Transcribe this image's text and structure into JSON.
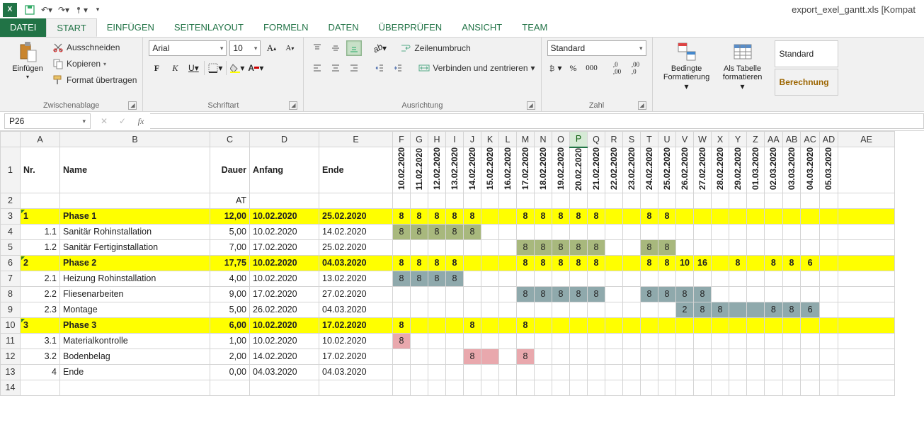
{
  "app": {
    "title": "export_exel_gantt.xls  [Kompat"
  },
  "tabs": {
    "datei": "DATEI",
    "start": "START",
    "einfuegen": "EINFÜGEN",
    "seitenlayout": "SEITENLAYOUT",
    "formeln": "FORMELN",
    "daten": "DATEN",
    "ueberpruefen": "ÜBERPRÜFEN",
    "ansicht": "ANSICHT",
    "team": "TEAM"
  },
  "ribbon": {
    "clipboard": {
      "paste": "Einfügen",
      "cut": "Ausschneiden",
      "copy": "Kopieren",
      "format_painter": "Format übertragen",
      "label": "Zwischenablage"
    },
    "font": {
      "name": "Arial",
      "size": "10",
      "bold": "F",
      "italic": "K",
      "underline": "U",
      "label": "Schriftart"
    },
    "align": {
      "wrap": "Zeilenumbruch",
      "merge": "Verbinden und zentrieren",
      "label": "Ausrichtung"
    },
    "number": {
      "format": "Standard",
      "label": "Zahl"
    },
    "styles": {
      "cond": "Bedingte\nFormatierung",
      "table": "Als Tabelle\nformatieren",
      "s1": "Standard",
      "s2": "Berechnung"
    }
  },
  "namebox": "P26",
  "columns": [
    "A",
    "B",
    "C",
    "D",
    "E",
    "F",
    "G",
    "H",
    "I",
    "J",
    "K",
    "L",
    "M",
    "N",
    "O",
    "P",
    "Q",
    "R",
    "S",
    "T",
    "U",
    "V",
    "W",
    "X",
    "Y",
    "Z",
    "AA",
    "AB",
    "AC",
    "AD",
    "AE"
  ],
  "dates": [
    "10.02.2020",
    "11.02.2020",
    "12.02.2020",
    "13.02.2020",
    "14.02.2020",
    "15.02.2020",
    "16.02.2020",
    "17.02.2020",
    "18.02.2020",
    "19.02.2020",
    "20.02.2020",
    "21.02.2020",
    "22.02.2020",
    "23.02.2020",
    "24.02.2020",
    "25.02.2020",
    "26.02.2020",
    "27.02.2020",
    "28.02.2020",
    "29.02.2020",
    "01.03.2020",
    "02.03.2020",
    "03.03.2020",
    "04.03.2020",
    "05.03.2020"
  ],
  "headers": {
    "nr": "Nr.",
    "name": "Name",
    "dauer": "Dauer",
    "anfang": "Anfang",
    "ende": "Ende",
    "at": "AT"
  },
  "rows": [
    {
      "r": 3,
      "phase": true,
      "nr": "1",
      "name": "Phase 1",
      "dauer": "12,00",
      "anfang": "10.02.2020",
      "ende": "25.02.2020",
      "cells": [
        {
          "d": 0,
          "v": "8"
        },
        {
          "d": 1,
          "v": "8"
        },
        {
          "d": 2,
          "v": "8"
        },
        {
          "d": 3,
          "v": "8"
        },
        {
          "d": 4,
          "v": "8"
        },
        {
          "d": 7,
          "v": "8"
        },
        {
          "d": 8,
          "v": "8"
        },
        {
          "d": 9,
          "v": "8"
        },
        {
          "d": 10,
          "v": "8"
        },
        {
          "d": 11,
          "v": "8"
        },
        {
          "d": 14,
          "v": "8"
        },
        {
          "d": 15,
          "v": "8"
        }
      ]
    },
    {
      "r": 4,
      "nr": "1.1",
      "name": "Sanitär Rohinstallation",
      "dauer": "5,00",
      "anfang": "10.02.2020",
      "ende": "14.02.2020",
      "cells": [
        {
          "d": 0,
          "v": "8",
          "c": "g1"
        },
        {
          "d": 1,
          "v": "8",
          "c": "g1"
        },
        {
          "d": 2,
          "v": "8",
          "c": "g1"
        },
        {
          "d": 3,
          "v": "8",
          "c": "g1"
        },
        {
          "d": 4,
          "v": "8",
          "c": "g1"
        }
      ]
    },
    {
      "r": 5,
      "nr": "1.2",
      "name": "Sanitär Fertiginstallation",
      "dauer": "7,00",
      "anfang": "17.02.2020",
      "ende": "25.02.2020",
      "cells": [
        {
          "d": 7,
          "v": "8",
          "c": "g1"
        },
        {
          "d": 8,
          "v": "8",
          "c": "g1"
        },
        {
          "d": 9,
          "v": "8",
          "c": "g1"
        },
        {
          "d": 10,
          "v": "8",
          "c": "g1"
        },
        {
          "d": 11,
          "v": "8",
          "c": "g1"
        },
        {
          "d": 14,
          "v": "8",
          "c": "g1"
        },
        {
          "d": 15,
          "v": "8",
          "c": "g1"
        }
      ]
    },
    {
      "r": 6,
      "phase": true,
      "nr": "2",
      "name": "Phase 2",
      "dauer": "17,75",
      "anfang": "10.02.2020",
      "ende": "04.03.2020",
      "cells": [
        {
          "d": 0,
          "v": "8"
        },
        {
          "d": 1,
          "v": "8"
        },
        {
          "d": 2,
          "v": "8"
        },
        {
          "d": 3,
          "v": "8"
        },
        {
          "d": 7,
          "v": "8"
        },
        {
          "d": 8,
          "v": "8"
        },
        {
          "d": 9,
          "v": "8"
        },
        {
          "d": 10,
          "v": "8"
        },
        {
          "d": 11,
          "v": "8"
        },
        {
          "d": 14,
          "v": "8"
        },
        {
          "d": 15,
          "v": "8"
        },
        {
          "d": 16,
          "v": "10"
        },
        {
          "d": 17,
          "v": "16"
        },
        {
          "d": 19,
          "v": "8"
        },
        {
          "d": 21,
          "v": "8"
        },
        {
          "d": 22,
          "v": "8"
        },
        {
          "d": 23,
          "v": "6"
        }
      ]
    },
    {
      "r": 7,
      "nr": "2.1",
      "name": "Heizung Rohinstallation",
      "dauer": "4,00",
      "anfang": "10.02.2020",
      "ende": "13.02.2020",
      "cells": [
        {
          "d": 0,
          "v": "8",
          "c": "g2"
        },
        {
          "d": 1,
          "v": "8",
          "c": "g2"
        },
        {
          "d": 2,
          "v": "8",
          "c": "g2"
        },
        {
          "d": 3,
          "v": "8",
          "c": "g2"
        }
      ]
    },
    {
      "r": 8,
      "nr": "2.2",
      "name": "Fliesenarbeiten",
      "dauer": "9,00",
      "anfang": "17.02.2020",
      "ende": "27.02.2020",
      "cells": [
        {
          "d": 7,
          "v": "8",
          "c": "g2"
        },
        {
          "d": 8,
          "v": "8",
          "c": "g2"
        },
        {
          "d": 9,
          "v": "8",
          "c": "g2"
        },
        {
          "d": 10,
          "v": "8",
          "c": "g2"
        },
        {
          "d": 11,
          "v": "8",
          "c": "g2"
        },
        {
          "d": 14,
          "v": "8",
          "c": "g2"
        },
        {
          "d": 15,
          "v": "8",
          "c": "g2"
        },
        {
          "d": 16,
          "v": "8",
          "c": "g2"
        },
        {
          "d": 17,
          "v": "8",
          "c": "g2"
        }
      ]
    },
    {
      "r": 9,
      "nr": "2.3",
      "name": "Montage",
      "dauer": "5,00",
      "anfang": "26.02.2020",
      "ende": "04.03.2020",
      "cells": [
        {
          "d": 16,
          "v": "2",
          "c": "g2"
        },
        {
          "d": 17,
          "v": "8",
          "c": "g2"
        },
        {
          "d": 18,
          "v": "8",
          "c": "g2"
        },
        {
          "d": 19,
          "v": "",
          "c": "g2"
        },
        {
          "d": 20,
          "v": "",
          "c": "g2"
        },
        {
          "d": 21,
          "v": "8",
          "c": "g2"
        },
        {
          "d": 22,
          "v": "8",
          "c": "g2"
        },
        {
          "d": 23,
          "v": "6",
          "c": "g2"
        }
      ]
    },
    {
      "r": 10,
      "phase": true,
      "nr": "3",
      "name": "Phase 3",
      "dauer": "6,00",
      "anfang": "10.02.2020",
      "ende": "17.02.2020",
      "cells": [
        {
          "d": 0,
          "v": "8"
        },
        {
          "d": 4,
          "v": "8"
        },
        {
          "d": 7,
          "v": "8"
        }
      ]
    },
    {
      "r": 11,
      "nr": "3.1",
      "name": "Materialkontrolle",
      "dauer": "1,00",
      "anfang": "10.02.2020",
      "ende": "10.02.2020",
      "cells": [
        {
          "d": 0,
          "v": "8",
          "c": "g3"
        }
      ]
    },
    {
      "r": 12,
      "nr": "3.2",
      "name": "Bodenbelag",
      "dauer": "2,00",
      "anfang": "14.02.2020",
      "ende": "17.02.2020",
      "cells": [
        {
          "d": 4,
          "v": "8",
          "c": "g3"
        },
        {
          "d": 5,
          "v": "",
          "c": "g3"
        },
        {
          "d": 7,
          "v": "8",
          "c": "g3"
        }
      ]
    },
    {
      "r": 13,
      "nr": "4",
      "name": "Ende",
      "dauer": "0,00",
      "anfang": "04.03.2020",
      "ende": "04.03.2020",
      "cells": []
    }
  ]
}
